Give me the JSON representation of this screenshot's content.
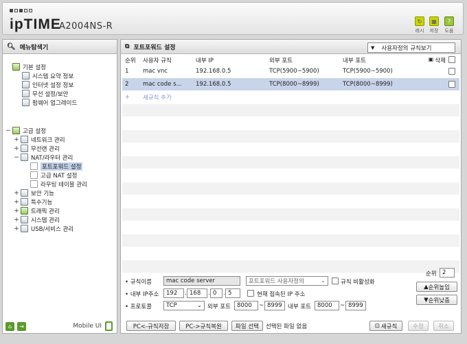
{
  "header": {
    "logo_text": "ipTIME",
    "model": "A2004NS-R",
    "buttons": [
      {
        "label": "레시",
        "icon": "refresh-icon"
      },
      {
        "label": "저장",
        "icon": "save-icon"
      },
      {
        "label": "도움",
        "icon": "help-icon"
      }
    ]
  },
  "sidebar": {
    "title": "메뉴탐색기",
    "basic_group": "기본 설정",
    "basic_items": [
      "시스템 요약 정보",
      "인터넷 설정 정보",
      "무선 설정/보안",
      "펌웨어 업그레이드"
    ],
    "advanced_group": "고급 설정",
    "advanced_items": [
      "네트워크 관리",
      "무선랜 관리",
      "NAT/라우터 관리"
    ],
    "nat_sub": [
      "포트포워드 설정",
      "고급 NAT 설정",
      "라우팅 테이블 관리"
    ],
    "advanced_more": [
      "보안 기능",
      "특수기능",
      "트래픽 관리",
      "시스템 관리",
      "USB/서비스 관리"
    ],
    "mobile_ui": "Mobile UI"
  },
  "main": {
    "title": "포트포워드 설정",
    "view_select": "사용자정의 규칙보기",
    "columns": [
      "순위",
      "사용자 규칙",
      "내부 IP",
      "외부 포트",
      "내부 포트",
      "삭제"
    ],
    "rows": [
      {
        "rank": "1",
        "name": "mac vnc",
        "ip": "192.168.0.5",
        "ext": "TCP(5900~5900)",
        "int": "TCP(5900~5900)"
      },
      {
        "rank": "2",
        "name": "mac code s...",
        "ip": "192.168.0.5",
        "ext": "TCP(8000~8999)",
        "int": "TCP(8000~8999)"
      }
    ],
    "add_rule": "새규칙 추가"
  },
  "form": {
    "rule_name_label": "규칙이름",
    "rule_name_value": "mac code server",
    "rule_type": "포트포워드 사용자정의",
    "disable_label": "규칙 비활성화",
    "ip_label": "내부 IP주소",
    "ip": [
      "192",
      "168",
      "0",
      "5"
    ],
    "current_ip_label": "현재 접속된 IP 주소",
    "protocol_label": "프로토콜",
    "protocol": "TCP",
    "ext_port_label": "외부 포트",
    "ext_from": "8000",
    "ext_to": "8999",
    "int_port_label": "내부 포트",
    "int_from": "8000",
    "int_to": "8999",
    "tilde": "~",
    "rank_label": "순위",
    "rank_value": "2",
    "rank_up": "순위높임",
    "rank_down": "순위낮춤",
    "btn_save_pc": "PC<-규칙저장",
    "btn_restore": "PC->규칙복원",
    "btn_file": "파일 선택",
    "file_status": "선택된 파일 없음",
    "btn_new": "새규칙",
    "btn_edit": "수정",
    "btn_cancel": "취소"
  }
}
